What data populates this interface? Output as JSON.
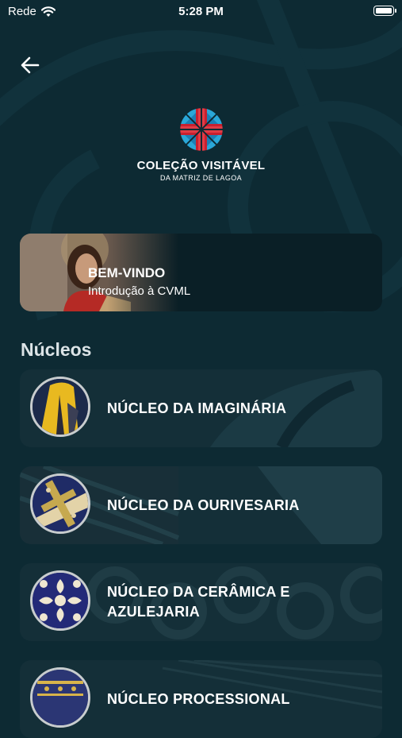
{
  "status_bar": {
    "carrier": "Rede",
    "time": "5:28 PM"
  },
  "header": {
    "back_icon": "arrow-left-icon",
    "logo_title": "COLEÇÃO VISITÁVEL",
    "logo_subtitle": "DA MATRIZ DE LAGOA"
  },
  "welcome": {
    "title": "BEM-VINDO",
    "subtitle": "Introdução à CVML"
  },
  "section": {
    "title": "Núcleos"
  },
  "nucleos": [
    {
      "label": "NÚCLEO DA IMAGINÁRIA"
    },
    {
      "label": "NÚCLEO DA OURIVESARIA"
    },
    {
      "label": "NÚCLEO DA CERÂMICA E AZULEJARIA"
    },
    {
      "label": "NÚCLEO PROCESSIONAL"
    }
  ],
  "colors": {
    "background": "#0d2a33",
    "card": "#142f38",
    "logo_red": "#c8202f",
    "logo_blue": "#2aa7d8"
  }
}
